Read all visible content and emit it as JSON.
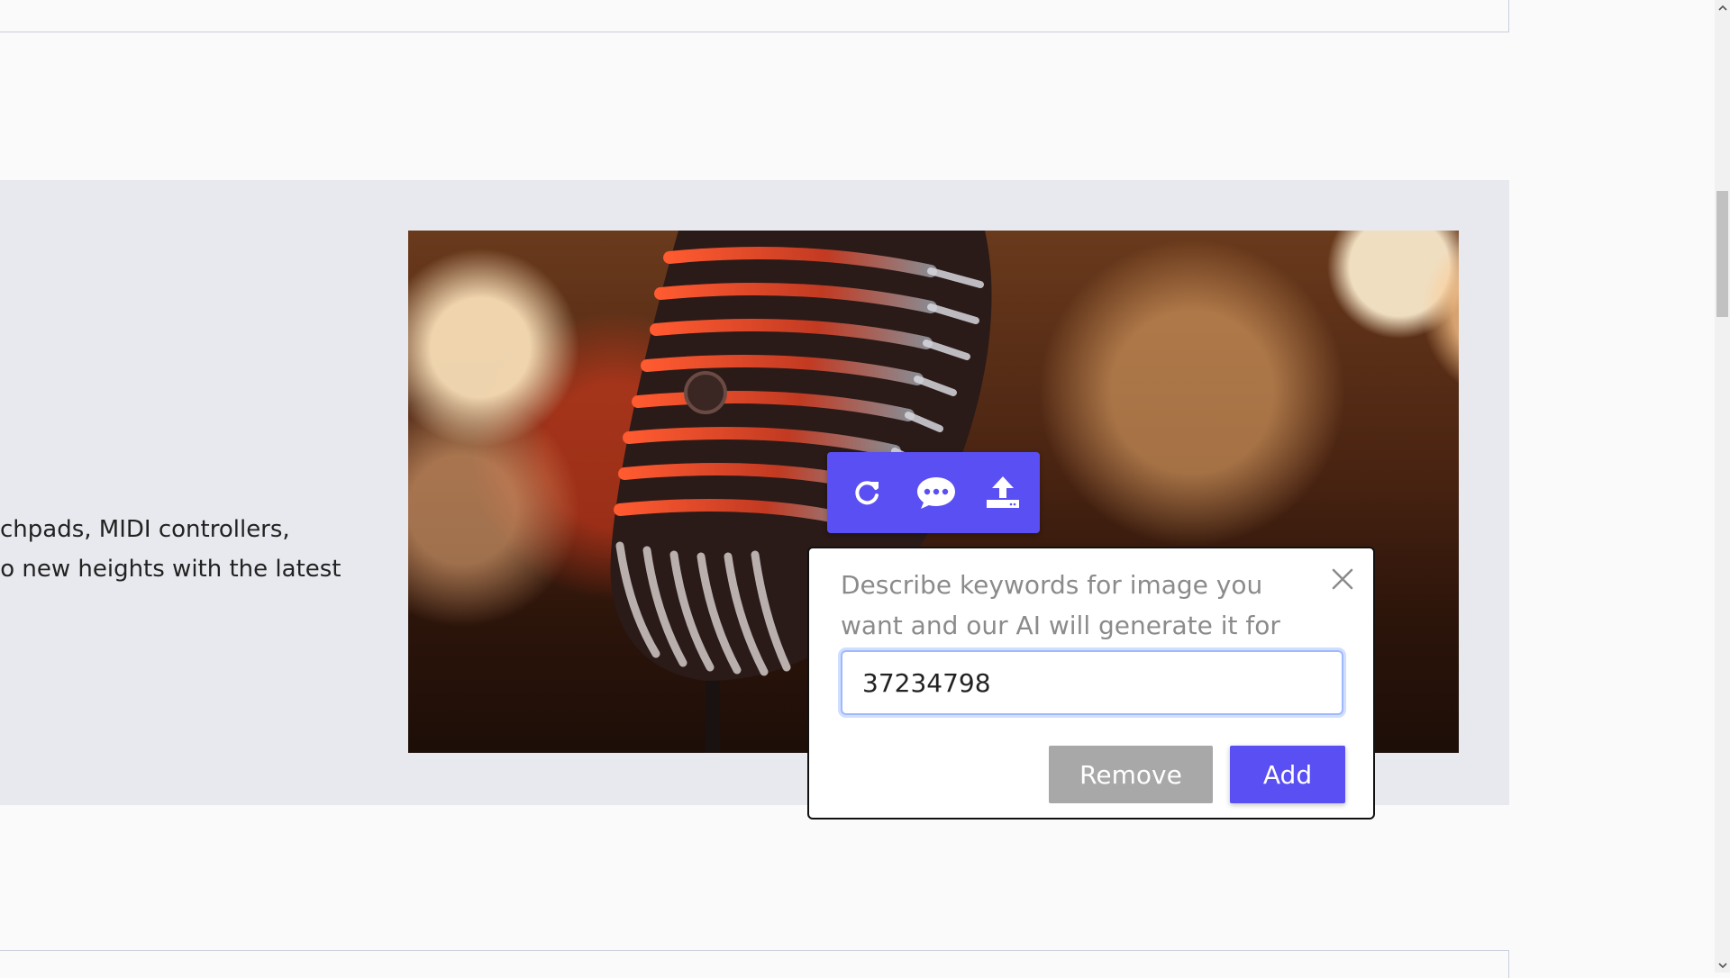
{
  "hero": {
    "text_line1": "chpads, MIDI controllers,",
    "text_line2": "to new heights with the latest",
    "image_alt": "microphone image"
  },
  "toolbar": {
    "icons": [
      "refresh-icon",
      "chat-icon",
      "upload-icon"
    ]
  },
  "dialog": {
    "message": "Describe keywords for image you want and our AI will generate it for you",
    "input_value": "37234798",
    "remove_label": "Remove",
    "add_label": "Add"
  },
  "colors": {
    "accent": "#5a4ff2",
    "remove_button": "#a8a8a8",
    "hero_background": "#e8e9ee"
  }
}
